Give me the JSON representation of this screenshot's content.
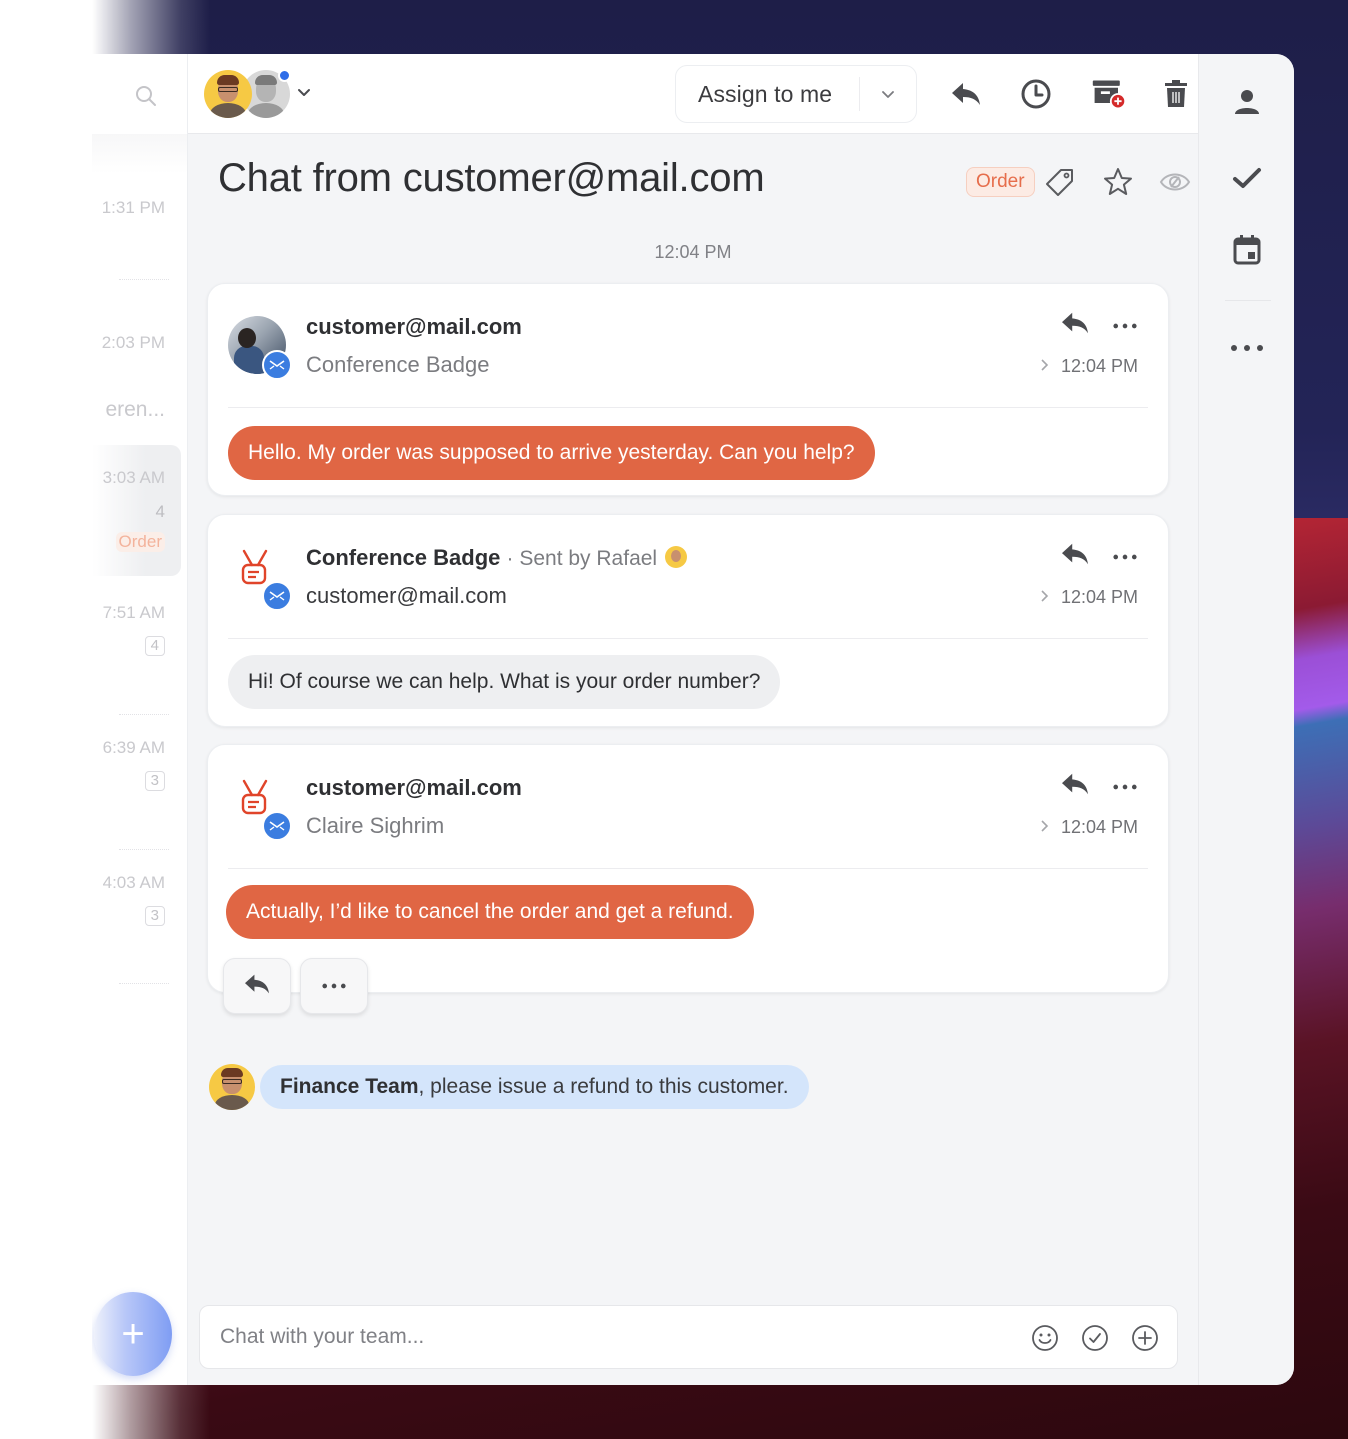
{
  "toolbar": {
    "search_icon": "search-icon",
    "assignees": [
      {
        "name": "Rafael",
        "avatar_color": "#f6c944"
      },
      {
        "name": "Colleague",
        "avatar_color": "#d8d8d8",
        "online": true
      }
    ],
    "assign_label": "Assign to me",
    "actions": [
      "reply-icon",
      "snooze-clock-icon",
      "archive-icon",
      "trash-icon",
      "more-icon"
    ]
  },
  "conversation": {
    "title": "Chat from customer@mail.com",
    "tag": "Order",
    "day_time": "12:04 PM"
  },
  "messages": [
    {
      "sender": "customer@mail.com",
      "sent_by": "",
      "subline": "Conference Badge",
      "time": "12:04 PM",
      "text": "Hello. My order was supposed to arrive yesterday. Can you help?",
      "direction": "customer"
    },
    {
      "sender": "Conference Badge",
      "sent_by": "· Sent by Rafael",
      "subline": "customer@mail.com",
      "time": "12:04 PM",
      "text": "Hi! Of course we can help. What is your order number?",
      "direction": "agent"
    },
    {
      "sender": "customer@mail.com",
      "sent_by": "",
      "subline": "Claire Sighrim",
      "time": "12:04 PM",
      "text": "Actually, I’d like to cancel the order and get a refund.",
      "direction": "customer"
    }
  ],
  "internal_note": {
    "mention": "Finance Team",
    "text": ", please issue a refund to this customer."
  },
  "composer": {
    "placeholder": "Chat with your team..."
  },
  "conversation_list": {
    "times": [
      "1:31 PM",
      "2:03 PM",
      "3:03 AM",
      "7:51 AM",
      "6:39 AM",
      "4:03 AM"
    ],
    "snippet": "eren...",
    "counts": [
      "4",
      "4",
      "3",
      "3"
    ],
    "selected_tag": "Order"
  },
  "colors": {
    "customer_bubble": "#e06644",
    "agent_bubble": "#eeeff1",
    "note_bubble": "#d4e5fb",
    "accent_blue": "#3b7de0",
    "tag_text": "#e66d4b"
  }
}
